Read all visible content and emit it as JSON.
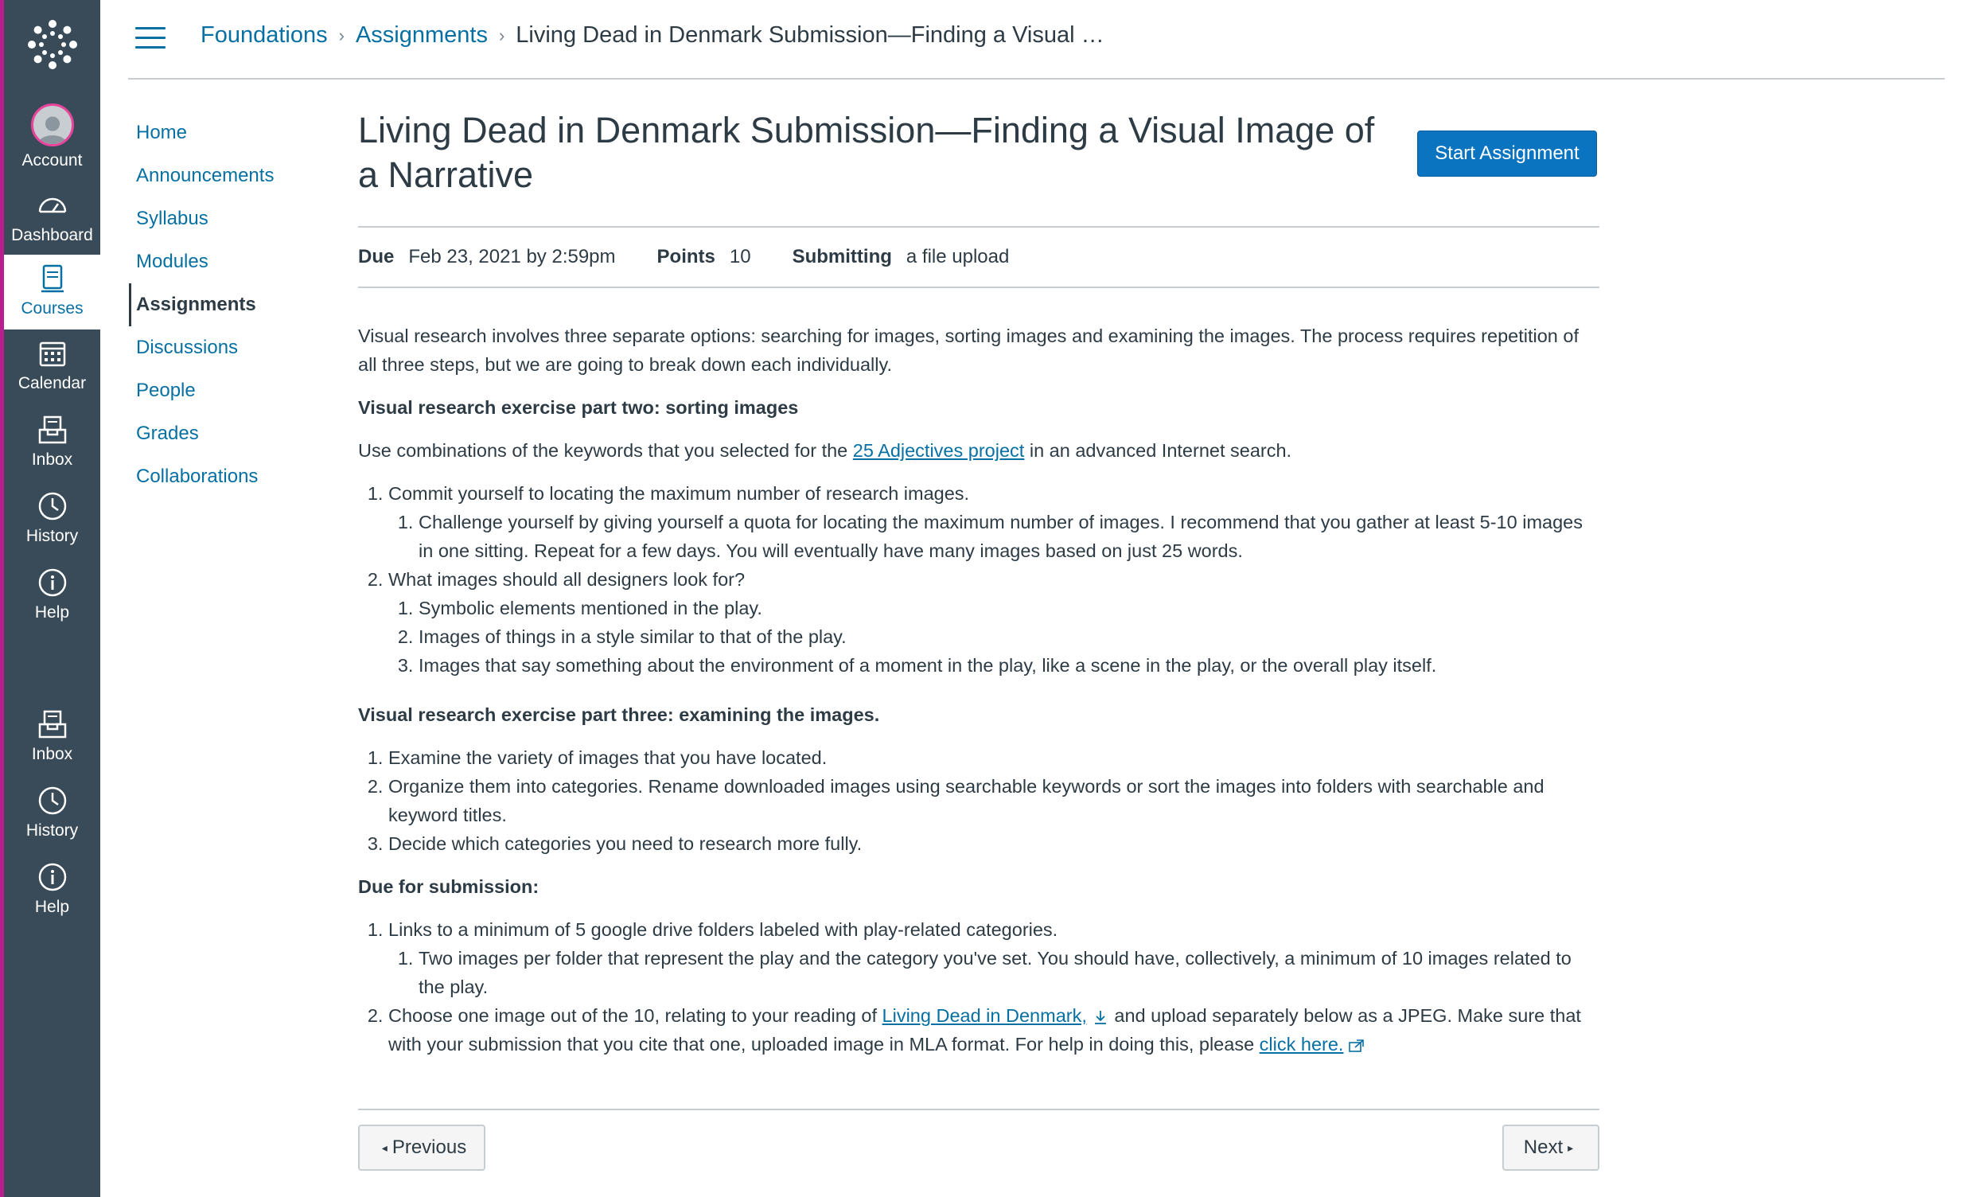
{
  "global_nav": {
    "items": [
      {
        "label": "Account",
        "icon": "account-avatar"
      },
      {
        "label": "Dashboard",
        "icon": "dashboard-icon"
      },
      {
        "label": "Courses",
        "icon": "courses-icon"
      },
      {
        "label": "Calendar",
        "icon": "calendar-icon"
      },
      {
        "label": "Inbox",
        "icon": "inbox-icon"
      },
      {
        "label": "History",
        "icon": "history-icon"
      },
      {
        "label": "Help",
        "icon": "help-icon"
      },
      {
        "label": "Inbox",
        "icon": "inbox-icon"
      },
      {
        "label": "History",
        "icon": "history-icon"
      },
      {
        "label": "Help",
        "icon": "help-icon"
      }
    ],
    "active": "Courses",
    "colors": {
      "background": "#394b58",
      "accent": "#b91e8f",
      "active_text": "#0770a3"
    }
  },
  "breadcrumb": {
    "items": [
      "Foundations",
      "Assignments"
    ],
    "current": "Living Dead in Denmark Submission—Finding a Visual …"
  },
  "course_nav": {
    "items": [
      "Home",
      "Announcements",
      "Syllabus",
      "Modules",
      "Assignments",
      "Discussions",
      "People",
      "Grades",
      "Collaborations"
    ],
    "active": "Assignments"
  },
  "assignment": {
    "title": "Living Dead in Denmark Submission—Finding a Visual Image of a Narrative",
    "start_button": "Start Assignment",
    "due_label": "Due",
    "due_value": "Feb 23, 2021 by 2:59pm",
    "points_label": "Points",
    "points_value": "10",
    "submitting_label": "Submitting",
    "submitting_value": "a file upload"
  },
  "body": {
    "intro": "Visual research involves three separate options: searching for images, sorting images and examining the images. The process requires repetition of all three steps, but we are going to break down each individually.",
    "part_two_heading": "Visual research exercise part two: sorting images",
    "part_two_text_before": "Use combinations of the keywords that you selected for the ",
    "part_two_link": "25 Adjectives project",
    "part_two_text_after": " in an advanced Internet search.",
    "list1": {
      "item1": "Commit yourself to locating the maximum number of research images.",
      "item1_sub1": "Challenge yourself by giving yourself a quota for locating the maximum number of images. I recommend that you gather at least 5-10 images in one sitting. Repeat for a few days. You will eventually have many images based on just 25 words.",
      "item2": "What images should all designers look for?",
      "item2_sub1": "Symbolic elements mentioned in the play.",
      "item2_sub2": "Images of things in a style similar to that of the play.",
      "item2_sub3": "Images that say something about the environment of a moment in the play, like a scene in the play, or the overall play itself."
    },
    "part_three_heading": "Visual research exercise part three: examining the images.",
    "list2": {
      "item1": "Examine the variety of images that you have located.",
      "item2": "Organize them into categories. Rename downloaded images using searchable keywords or sort the images into folders with searchable and keyword titles.",
      "item3": "Decide which categories you need to research more fully."
    },
    "due_heading": "Due for submission:",
    "list3": {
      "item1": "Links to a minimum of 5 google drive folders labeled with play-related categories.",
      "item1_sub1": "Two images per folder that represent the play and the category you've set. You should have, collectively, a minimum of 10 images related to the play.",
      "item2_before": "Choose one image out of the 10, relating to your reading of ",
      "item2_link": "Living Dead in Denmark,",
      "item2_middle": " and upload separately below as a JPEG. Make sure that with your submission that you cite that one, uploaded image in MLA format. For help in doing this, please ",
      "item2_link2": "click here."
    }
  },
  "pager": {
    "previous": "Previous",
    "next": "Next"
  }
}
